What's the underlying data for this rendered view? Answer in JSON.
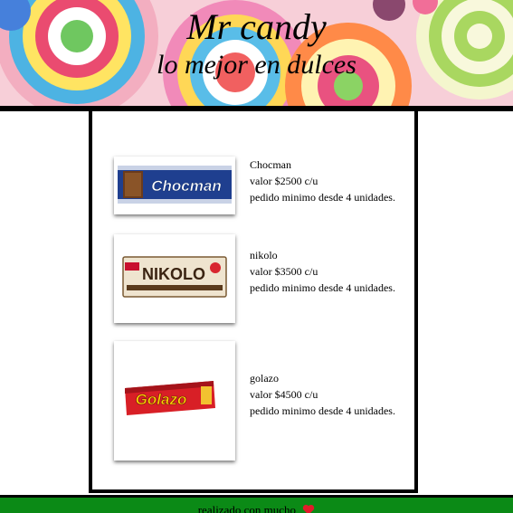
{
  "header": {
    "title": "Mr candy",
    "subtitle": "lo mejor en dulces"
  },
  "products": [
    {
      "name": "Chocman",
      "price": "valor $2500 c/u",
      "min_order": "pedido minimo desde 4 unidades.",
      "brand_text": "Chocman",
      "brand_color": "#1c3f8f"
    },
    {
      "name": "nikolo",
      "price": "valor $3500 c/u",
      "min_order": "pedido minimo desde 4 unidades.",
      "brand_text": "NIKOLO",
      "brand_color": "#5a3a1c"
    },
    {
      "name": "golazo",
      "price": "valor $4500 c/u",
      "min_order": "pedido minimo desde 4 unidades.",
      "brand_text": "Golazo",
      "brand_color": "#d81f26"
    }
  ],
  "footer": {
    "text": "realizado con mucho",
    "heart_icon": "heart-icon",
    "bg_color": "#0b8a16"
  }
}
